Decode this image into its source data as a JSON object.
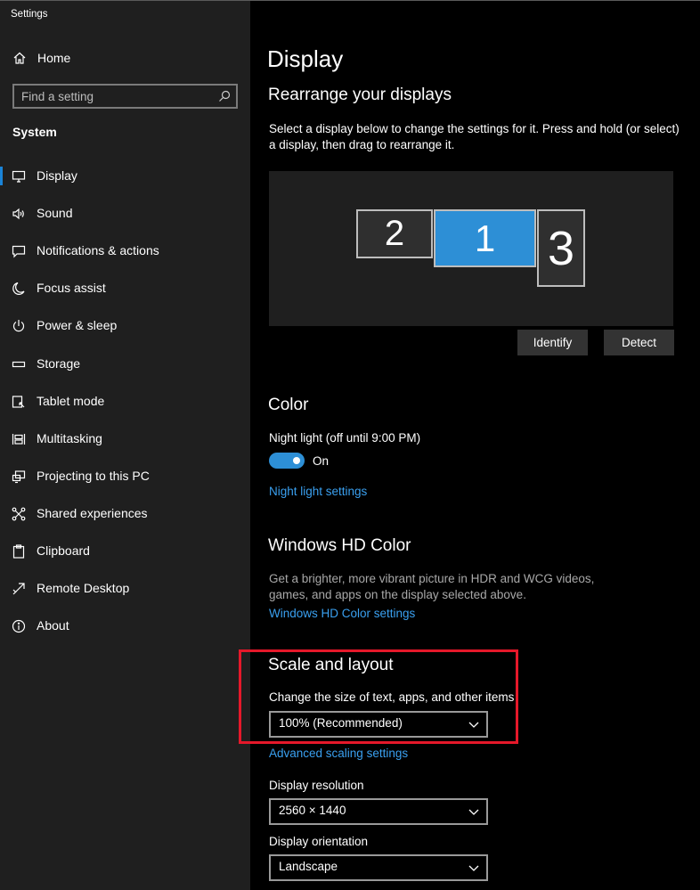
{
  "window": {
    "title": "Settings"
  },
  "sidebar": {
    "home_label": "Home",
    "search_placeholder": "Find a setting",
    "section_label": "System",
    "items": [
      {
        "label": "Display",
        "icon": "monitor-icon",
        "active": true
      },
      {
        "label": "Sound",
        "icon": "speaker-icon"
      },
      {
        "label": "Notifications & actions",
        "icon": "notification-icon"
      },
      {
        "label": "Focus assist",
        "icon": "moon-icon"
      },
      {
        "label": "Power & sleep",
        "icon": "power-icon"
      },
      {
        "label": "Storage",
        "icon": "storage-icon"
      },
      {
        "label": "Tablet mode",
        "icon": "tablet-icon"
      },
      {
        "label": "Multitasking",
        "icon": "multitasking-icon"
      },
      {
        "label": "Projecting to this PC",
        "icon": "projecting-icon"
      },
      {
        "label": "Shared experiences",
        "icon": "shared-icon"
      },
      {
        "label": "Clipboard",
        "icon": "clipboard-icon"
      },
      {
        "label": "Remote Desktop",
        "icon": "remote-desktop-icon"
      },
      {
        "label": "About",
        "icon": "info-icon"
      }
    ]
  },
  "main": {
    "title": "Display",
    "rearrange": {
      "heading": "Rearrange your displays",
      "description": "Select a display below to change the settings for it. Press and hold (or select) a display, then drag to rearrange it.",
      "monitors": [
        "2",
        "1",
        "3"
      ],
      "identify_label": "Identify",
      "detect_label": "Detect"
    },
    "color": {
      "heading": "Color",
      "night_light_label": "Night light (off until 9:00 PM)",
      "toggle_state": "On",
      "night_light_link": "Night light settings"
    },
    "hd_color": {
      "heading": "Windows HD Color",
      "description": "Get a brighter, more vibrant picture in HDR and WCG videos, games, and apps on the display selected above.",
      "link": "Windows HD Color settings"
    },
    "scale": {
      "heading": "Scale and layout",
      "size_label": "Change the size of text, apps, and other items",
      "size_value": "100% (Recommended)",
      "advanced_link": "Advanced scaling settings",
      "resolution_label": "Display resolution",
      "resolution_value": "2560 × 1440",
      "orientation_label": "Display orientation",
      "orientation_value": "Landscape"
    }
  },
  "colors": {
    "accent": "#2d8fd6",
    "link": "#3aa0f0",
    "highlight": "#e5182a",
    "sidebar_bg": "#1f1f1f",
    "main_bg": "#000000"
  }
}
